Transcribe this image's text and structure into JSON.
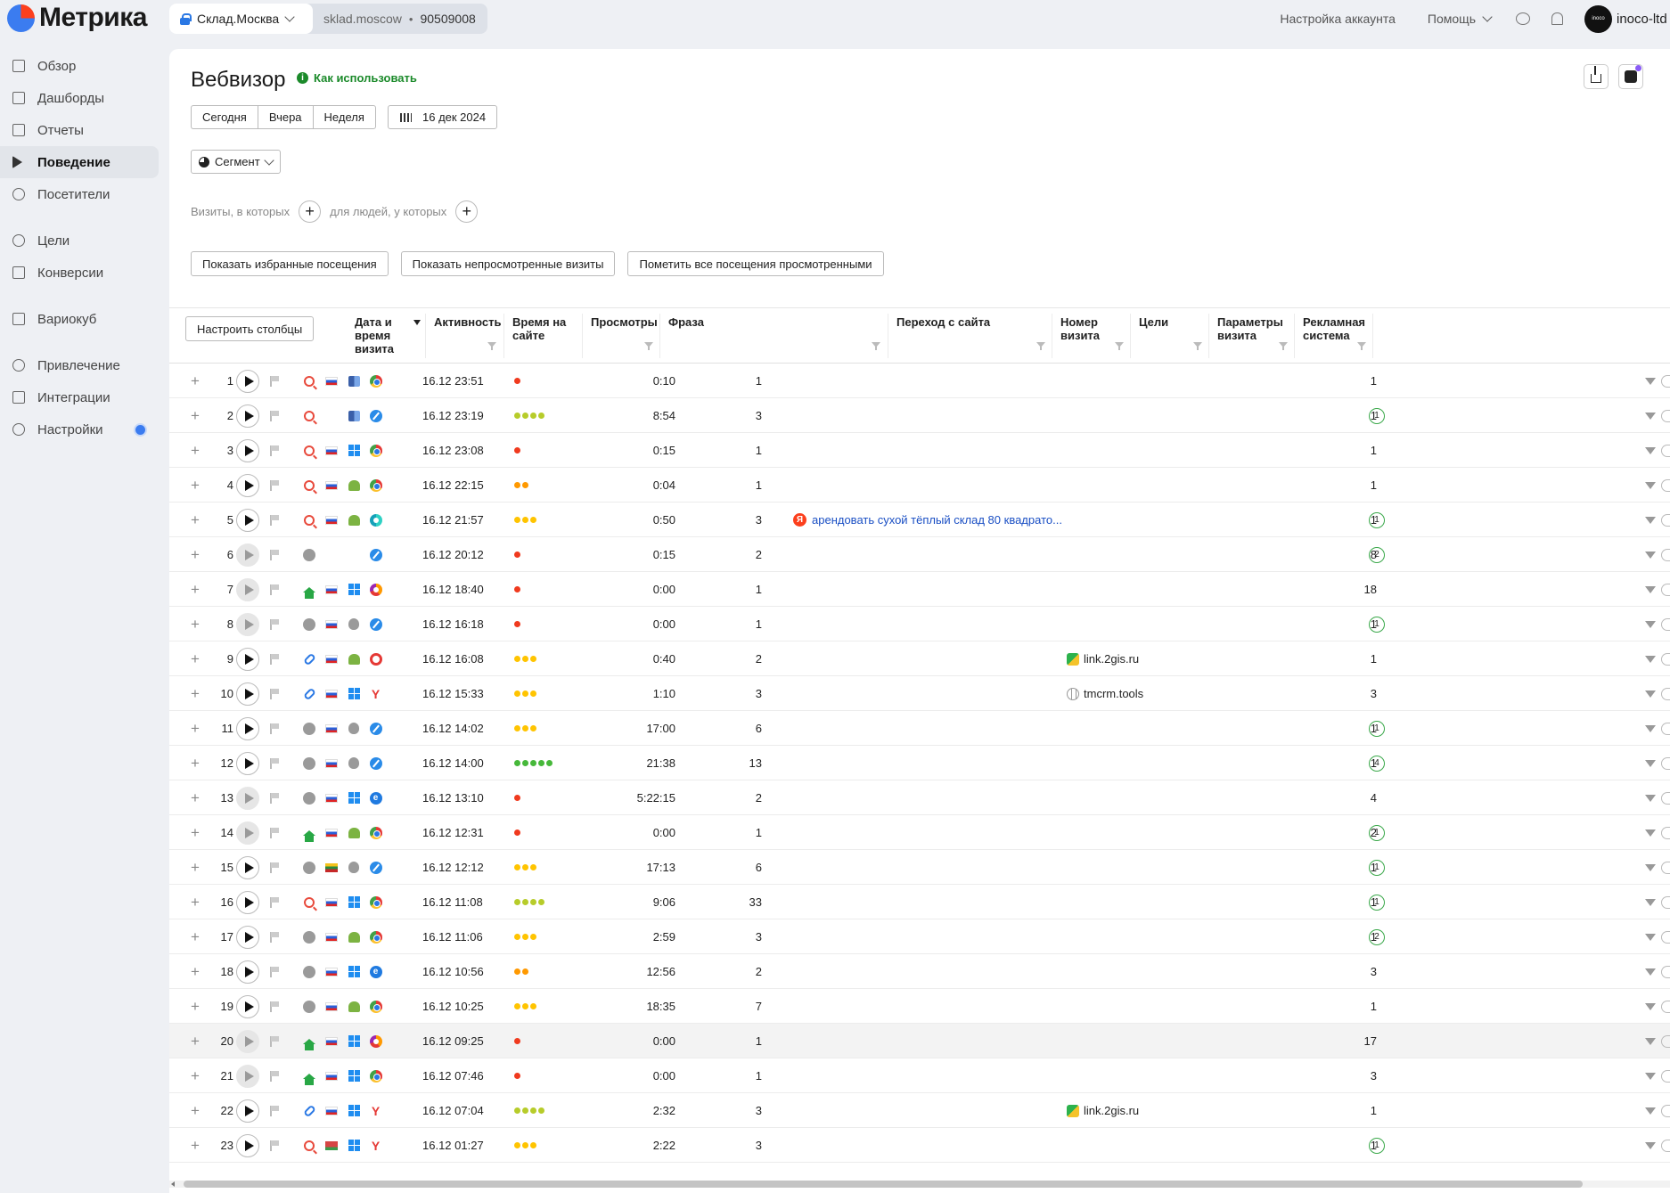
{
  "app": {
    "logo_text": "Метрика"
  },
  "counter": {
    "name": "Склад.Москва",
    "site": "sklad.moscow",
    "id": "90509008"
  },
  "topbar": {
    "account_settings": "Настройка аккаунта",
    "help": "Помощь",
    "account_name": "inoco-ltd",
    "avatar_text": "inoco"
  },
  "sidebar": {
    "items": [
      {
        "label": "Обзор",
        "icon": "grid-icon"
      },
      {
        "label": "Дашборды",
        "icon": "dashboard-icon"
      },
      {
        "label": "Отчеты",
        "icon": "bar-chart-icon"
      },
      {
        "label": "Поведение",
        "icon": "play-icon",
        "active": true
      },
      {
        "label": "Посетители",
        "icon": "person-icon"
      },
      {
        "label": "Цели",
        "icon": "target-icon"
      },
      {
        "label": "Конверсии",
        "icon": "percent-icon"
      },
      {
        "label": "Вариокуб",
        "icon": "cube-icon"
      },
      {
        "label": "Привлечение",
        "icon": "flame-icon"
      },
      {
        "label": "Интеграции",
        "icon": "integration-icon"
      },
      {
        "label": "Настройки",
        "icon": "gear-icon"
      }
    ]
  },
  "page": {
    "title": "Вебвизор",
    "howto": "Как использовать",
    "periods": [
      "Сегодня",
      "Вчера",
      "Неделя"
    ],
    "date": "16 дек 2024",
    "segment": "Сегмент",
    "filter_visits": "Визиты, в которых",
    "filter_people": "для людей, у которых",
    "actions": [
      "Показать избранные посещения",
      "Показать непросмотренные визиты",
      "Пометить все посещения просмотренными"
    ]
  },
  "table": {
    "configure": "Настроить столбцы",
    "headers": {
      "date": "Дата и время визита",
      "activity": "Активность",
      "time": "Время на сайте",
      "views": "Просмотры",
      "phrase": "Фраза",
      "referrer": "Переход с сайта",
      "visit_no": "Номер визита",
      "goals": "Цели",
      "params": "Параметры визита",
      "ad_system": "Рекламная система"
    },
    "activity_colors": {
      "1": "#f03a1e",
      "2": "#ff9900",
      "3": "#ffc400",
      "4": "#b7cc2a",
      "5": "#46b83a"
    },
    "rows": [
      {
        "n": "1",
        "play": true,
        "src": "search",
        "flag": "ru",
        "os": "multi",
        "br": "chrome",
        "date": "16.12 23:51",
        "act": 1,
        "time": "0:10",
        "views": "1",
        "phrase": "",
        "ref": "",
        "ref_icon": "",
        "visit": "1",
        "goals": ""
      },
      {
        "n": "2",
        "play": true,
        "src": "search",
        "flag": "",
        "os": "multi",
        "br": "safari",
        "date": "16.12 23:19",
        "act": 4,
        "time": "8:54",
        "views": "3",
        "phrase": "",
        "ref": "",
        "ref_icon": "",
        "visit": "1",
        "goals": "1"
      },
      {
        "n": "3",
        "play": true,
        "src": "search",
        "flag": "ru",
        "os": "win",
        "br": "chrome",
        "date": "16.12 23:08",
        "act": 1,
        "time": "0:15",
        "views": "1",
        "phrase": "",
        "ref": "",
        "ref_icon": "",
        "visit": "1",
        "goals": ""
      },
      {
        "n": "4",
        "play": true,
        "src": "search",
        "flag": "ru",
        "os": "android",
        "br": "chrome",
        "date": "16.12 22:15",
        "act": 2,
        "time": "0:04",
        "views": "1",
        "phrase": "",
        "ref": "",
        "ref_icon": "",
        "visit": "1",
        "goals": ""
      },
      {
        "n": "5",
        "play": true,
        "src": "search",
        "flag": "ru",
        "os": "android",
        "br": "ybrowser",
        "date": "16.12 21:57",
        "act": 3,
        "time": "0:50",
        "views": "3",
        "phrase": "арендовать сухой тёплый склад 80 квадрато...",
        "ref": "",
        "ref_icon": "",
        "visit": "1",
        "goals": "1"
      },
      {
        "n": "6",
        "play": false,
        "src": "enter",
        "flag": "",
        "os": "",
        "br": "safari",
        "date": "16.12 20:12",
        "act": 1,
        "time": "0:15",
        "views": "2",
        "phrase": "",
        "ref": "",
        "ref_icon": "",
        "visit": "8",
        "goals": "2"
      },
      {
        "n": "7",
        "play": false,
        "src": "home",
        "flag": "ru",
        "os": "win",
        "br": "firefox",
        "date": "16.12 18:40",
        "act": 1,
        "time": "0:00",
        "views": "1",
        "phrase": "",
        "ref": "",
        "ref_icon": "",
        "visit": "18",
        "goals": ""
      },
      {
        "n": "8",
        "play": false,
        "src": "enter",
        "flag": "ru",
        "os": "apple",
        "br": "safari",
        "date": "16.12 16:18",
        "act": 1,
        "time": "0:00",
        "views": "1",
        "phrase": "",
        "ref": "",
        "ref_icon": "",
        "visit": "1",
        "goals": "1"
      },
      {
        "n": "9",
        "play": true,
        "src": "link",
        "flag": "ru",
        "os": "android",
        "br": "opera",
        "date": "16.12 16:08",
        "act": 3,
        "time": "0:40",
        "views": "2",
        "phrase": "",
        "ref": "link.2gis.ru",
        "ref_icon": "twogis",
        "visit": "1",
        "goals": ""
      },
      {
        "n": "10",
        "play": true,
        "src": "link",
        "flag": "ru",
        "os": "win",
        "br": "yandex",
        "date": "16.12 15:33",
        "act": 3,
        "time": "1:10",
        "views": "3",
        "phrase": "",
        "ref": "tmcrm.tools",
        "ref_icon": "globe",
        "visit": "3",
        "goals": ""
      },
      {
        "n": "11",
        "play": true,
        "src": "enter",
        "flag": "ru",
        "os": "apple",
        "br": "safari",
        "date": "16.12 14:02",
        "act": 3,
        "time": "17:00",
        "views": "6",
        "phrase": "",
        "ref": "",
        "ref_icon": "",
        "visit": "1",
        "goals": "1"
      },
      {
        "n": "12",
        "play": true,
        "src": "enter",
        "flag": "ru",
        "os": "apple",
        "br": "safari",
        "date": "16.12 14:00",
        "act": 5,
        "time": "21:38",
        "views": "13",
        "phrase": "",
        "ref": "",
        "ref_icon": "",
        "visit": "1",
        "goals": "4"
      },
      {
        "n": "13",
        "play": false,
        "src": "enter",
        "flag": "ru",
        "os": "win",
        "br": "edge",
        "date": "16.12 13:10",
        "act": 1,
        "time": "5:22:15",
        "views": "2",
        "phrase": "",
        "ref": "",
        "ref_icon": "",
        "visit": "4",
        "goals": ""
      },
      {
        "n": "14",
        "play": false,
        "src": "home",
        "flag": "ru",
        "os": "android",
        "br": "chrome",
        "date": "16.12 12:31",
        "act": 1,
        "time": "0:00",
        "views": "1",
        "phrase": "",
        "ref": "",
        "ref_icon": "",
        "visit": "2",
        "goals": "1"
      },
      {
        "n": "15",
        "play": true,
        "src": "enter",
        "flag": "lt",
        "os": "apple",
        "br": "safari",
        "date": "16.12 12:12",
        "act": 3,
        "time": "17:13",
        "views": "6",
        "phrase": "",
        "ref": "",
        "ref_icon": "",
        "visit": "1",
        "goals": "1"
      },
      {
        "n": "16",
        "play": true,
        "src": "search",
        "flag": "ru",
        "os": "win",
        "br": "chrome",
        "date": "16.12 11:08",
        "act": 4,
        "time": "9:06",
        "views": "33",
        "phrase": "",
        "ref": "",
        "ref_icon": "",
        "visit": "1",
        "goals": "1"
      },
      {
        "n": "17",
        "play": true,
        "src": "enter",
        "flag": "ru",
        "os": "android",
        "br": "chrome",
        "date": "16.12 11:06",
        "act": 3,
        "time": "2:59",
        "views": "3",
        "phrase": "",
        "ref": "",
        "ref_icon": "",
        "visit": "1",
        "goals": "2"
      },
      {
        "n": "18",
        "play": true,
        "src": "enter",
        "flag": "ru",
        "os": "win",
        "br": "edge",
        "date": "16.12 10:56",
        "act": 2,
        "time": "12:56",
        "views": "2",
        "phrase": "",
        "ref": "",
        "ref_icon": "",
        "visit": "3",
        "goals": ""
      },
      {
        "n": "19",
        "play": true,
        "src": "enter",
        "flag": "ru",
        "os": "android",
        "br": "chrome",
        "date": "16.12 10:25",
        "act": 3,
        "time": "18:35",
        "views": "7",
        "phrase": "",
        "ref": "",
        "ref_icon": "",
        "visit": "1",
        "goals": ""
      },
      {
        "n": "20",
        "play": false,
        "src": "home",
        "flag": "ru",
        "os": "win",
        "br": "firefox",
        "date": "16.12 09:25",
        "act": 1,
        "time": "0:00",
        "views": "1",
        "phrase": "",
        "ref": "",
        "ref_icon": "",
        "visit": "17",
        "goals": "",
        "highlight": true
      },
      {
        "n": "21",
        "play": false,
        "src": "home",
        "flag": "ru",
        "os": "win",
        "br": "chrome",
        "date": "16.12 07:46",
        "act": 1,
        "time": "0:00",
        "views": "1",
        "phrase": "",
        "ref": "",
        "ref_icon": "",
        "visit": "3",
        "goals": ""
      },
      {
        "n": "22",
        "play": true,
        "src": "link",
        "flag": "ru",
        "os": "win",
        "br": "yandex",
        "date": "16.12 07:04",
        "act": 4,
        "time": "2:32",
        "views": "3",
        "phrase": "",
        "ref": "link.2gis.ru",
        "ref_icon": "twogis",
        "visit": "1",
        "goals": ""
      },
      {
        "n": "23",
        "play": true,
        "src": "search",
        "flag": "by",
        "os": "win",
        "br": "yandex",
        "date": "16.12 01:27",
        "act": 3,
        "time": "2:22",
        "views": "3",
        "phrase": "",
        "ref": "",
        "ref_icon": "",
        "visit": "1",
        "goals": "1"
      }
    ]
  }
}
